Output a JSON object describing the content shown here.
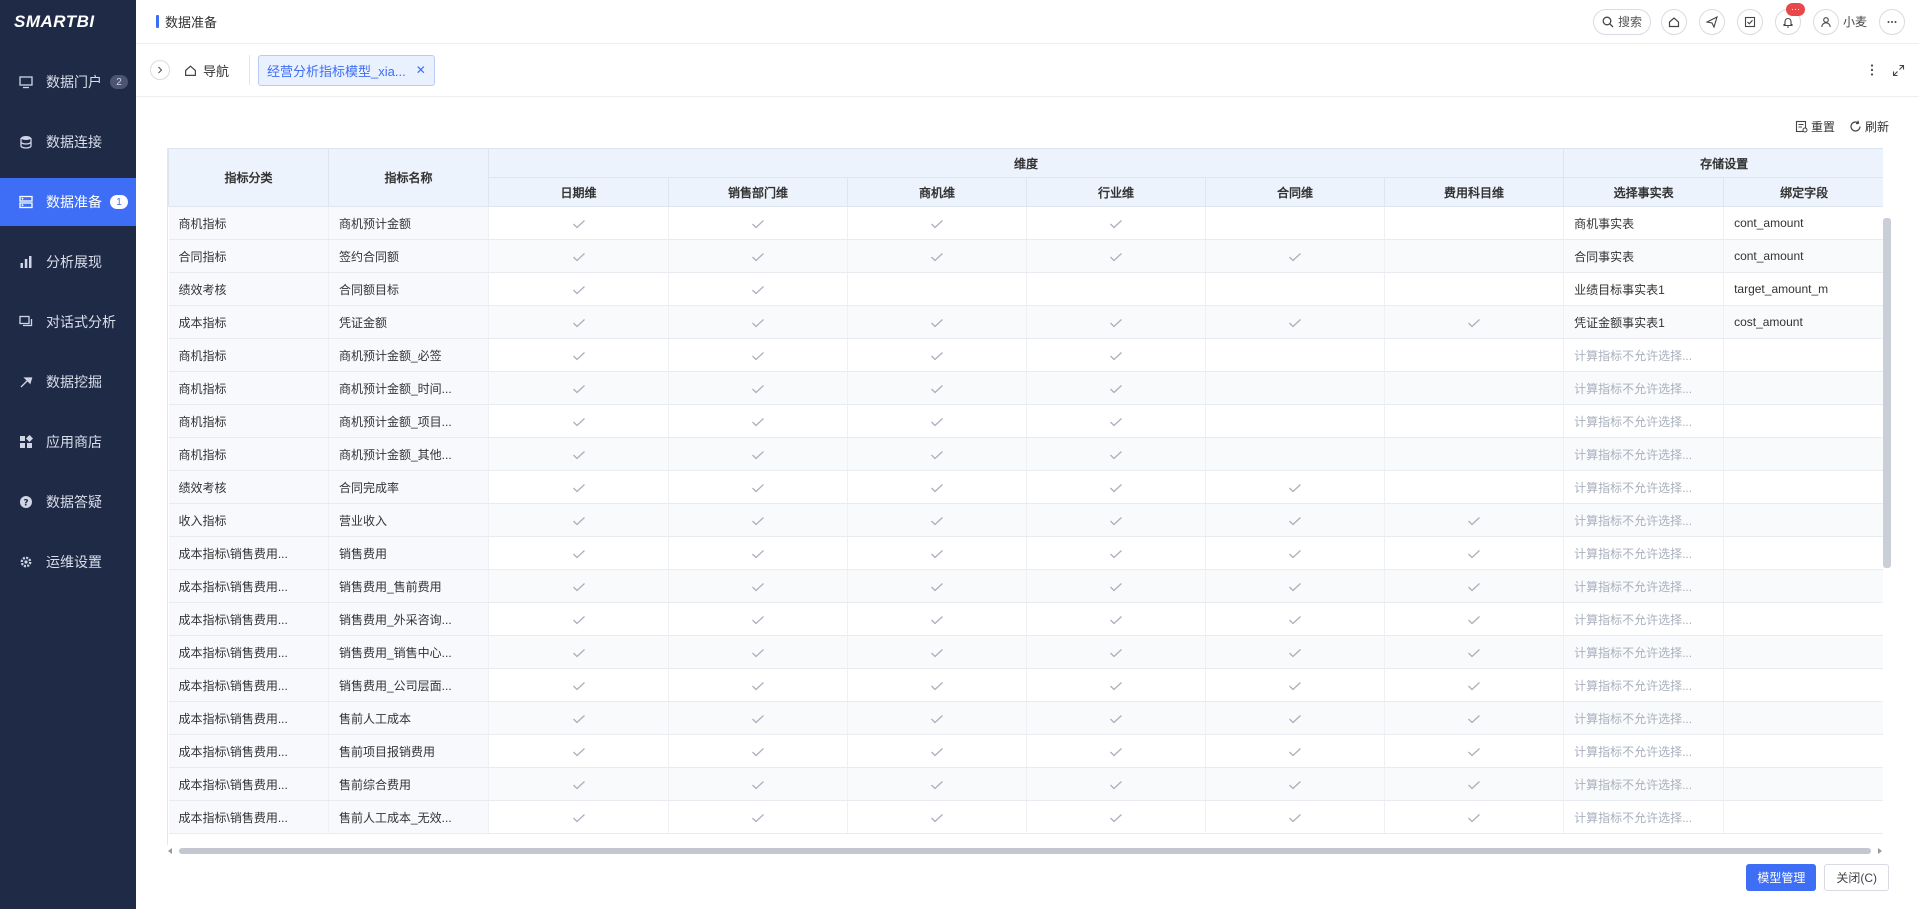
{
  "app": {
    "logo": "SMARTBI"
  },
  "sidebar": {
    "items": [
      {
        "label": "数据门户",
        "icon": "monitor-icon",
        "badge": "2"
      },
      {
        "label": "数据连接",
        "icon": "database-icon",
        "badge": ""
      },
      {
        "label": "数据准备",
        "icon": "server-icon",
        "badge": "1"
      },
      {
        "label": "分析展现",
        "icon": "bar-chart-icon",
        "badge": ""
      },
      {
        "label": "对话式分析",
        "icon": "chat-icon",
        "badge": ""
      },
      {
        "label": "数据挖掘",
        "icon": "pick-icon",
        "badge": ""
      },
      {
        "label": "应用商店",
        "icon": "app-grid-icon",
        "badge": ""
      },
      {
        "label": "数据答疑",
        "icon": "question-icon",
        "badge": ""
      },
      {
        "label": "运维设置",
        "icon": "gear-icon",
        "badge": ""
      }
    ],
    "active": "数据准备"
  },
  "header": {
    "page_title": "数据准备",
    "search_label": "搜索",
    "notification_badge": "···",
    "user_name": "小麦"
  },
  "tabs": {
    "home_label": "导航",
    "active_tab": "经营分析指标模型_xia..."
  },
  "toolbar": {
    "reset": "重置",
    "refresh": "刷新"
  },
  "table": {
    "group_headers": {
      "dimension": "维度",
      "storage": "存储设置"
    },
    "columns": {
      "category": "指标分类",
      "name": "指标名称",
      "dims": [
        "日期维",
        "销售部门维",
        "商机维",
        "行业维",
        "合同维",
        "费用科目维"
      ],
      "fact_table": "选择事实表",
      "bind_field": "绑定字段"
    },
    "rows": [
      {
        "category": "商机指标",
        "name": "商机预计金额",
        "dims": [
          1,
          1,
          1,
          1,
          0,
          0
        ],
        "fact": "商机事实表",
        "field": "cont_amount",
        "calc": false
      },
      {
        "category": "合同指标",
        "name": "签约合同额",
        "dims": [
          1,
          1,
          1,
          1,
          1,
          0
        ],
        "fact": "合同事实表",
        "field": "cont_amount",
        "calc": false
      },
      {
        "category": "绩效考核",
        "name": "合同额目标",
        "dims": [
          1,
          1,
          0,
          0,
          0,
          0
        ],
        "fact": "业绩目标事实表1",
        "field": "target_amount_m",
        "calc": false
      },
      {
        "category": "成本指标",
        "name": "凭证金额",
        "dims": [
          1,
          1,
          1,
          1,
          1,
          1
        ],
        "fact": "凭证金额事实表1",
        "field": "cost_amount",
        "calc": false
      },
      {
        "category": "商机指标",
        "name": "商机预计金额_必签",
        "dims": [
          1,
          1,
          1,
          1,
          0,
          0
        ],
        "fact": "计算指标不允许选择...",
        "field": "",
        "calc": true
      },
      {
        "category": "商机指标",
        "name": "商机预计金额_时间...",
        "dims": [
          1,
          1,
          1,
          1,
          0,
          0
        ],
        "fact": "计算指标不允许选择...",
        "field": "",
        "calc": true
      },
      {
        "category": "商机指标",
        "name": "商机预计金额_项目...",
        "dims": [
          1,
          1,
          1,
          1,
          0,
          0
        ],
        "fact": "计算指标不允许选择...",
        "field": "",
        "calc": true
      },
      {
        "category": "商机指标",
        "name": "商机预计金额_其他...",
        "dims": [
          1,
          1,
          1,
          1,
          0,
          0
        ],
        "fact": "计算指标不允许选择...",
        "field": "",
        "calc": true
      },
      {
        "category": "绩效考核",
        "name": "合同完成率",
        "dims": [
          1,
          1,
          1,
          1,
          1,
          0
        ],
        "fact": "计算指标不允许选择...",
        "field": "",
        "calc": true
      },
      {
        "category": "收入指标",
        "name": "营业收入",
        "dims": [
          1,
          1,
          1,
          1,
          1,
          1
        ],
        "fact": "计算指标不允许选择...",
        "field": "",
        "calc": true
      },
      {
        "category": "成本指标\\销售费用...",
        "name": "销售费用",
        "dims": [
          1,
          1,
          1,
          1,
          1,
          1
        ],
        "fact": "计算指标不允许选择...",
        "field": "",
        "calc": true
      },
      {
        "category": "成本指标\\销售费用...",
        "name": "销售费用_售前费用",
        "dims": [
          1,
          1,
          1,
          1,
          1,
          1
        ],
        "fact": "计算指标不允许选择...",
        "field": "",
        "calc": true
      },
      {
        "category": "成本指标\\销售费用...",
        "name": "销售费用_外采咨询...",
        "dims": [
          1,
          1,
          1,
          1,
          1,
          1
        ],
        "fact": "计算指标不允许选择...",
        "field": "",
        "calc": true
      },
      {
        "category": "成本指标\\销售费用...",
        "name": "销售费用_销售中心...",
        "dims": [
          1,
          1,
          1,
          1,
          1,
          1
        ],
        "fact": "计算指标不允许选择...",
        "field": "",
        "calc": true
      },
      {
        "category": "成本指标\\销售费用...",
        "name": "销售费用_公司层面...",
        "dims": [
          1,
          1,
          1,
          1,
          1,
          1
        ],
        "fact": "计算指标不允许选择...",
        "field": "",
        "calc": true
      },
      {
        "category": "成本指标\\销售费用...",
        "name": "售前人工成本",
        "dims": [
          1,
          1,
          1,
          1,
          1,
          1
        ],
        "fact": "计算指标不允许选择...",
        "field": "",
        "calc": true
      },
      {
        "category": "成本指标\\销售费用...",
        "name": "售前项目报销费用",
        "dims": [
          1,
          1,
          1,
          1,
          1,
          1
        ],
        "fact": "计算指标不允许选择...",
        "field": "",
        "calc": true
      },
      {
        "category": "成本指标\\销售费用...",
        "name": "售前综合费用",
        "dims": [
          1,
          1,
          1,
          1,
          1,
          1
        ],
        "fact": "计算指标不允许选择...",
        "field": "",
        "calc": true
      },
      {
        "category": "成本指标\\销售费用...",
        "name": "售前人工成本_无效...",
        "dims": [
          1,
          1,
          1,
          1,
          1,
          1
        ],
        "fact": "计算指标不允许选择...",
        "field": "",
        "calc": true
      }
    ]
  },
  "footer": {
    "model_manage": "模型管理",
    "close": "关闭(C)"
  }
}
